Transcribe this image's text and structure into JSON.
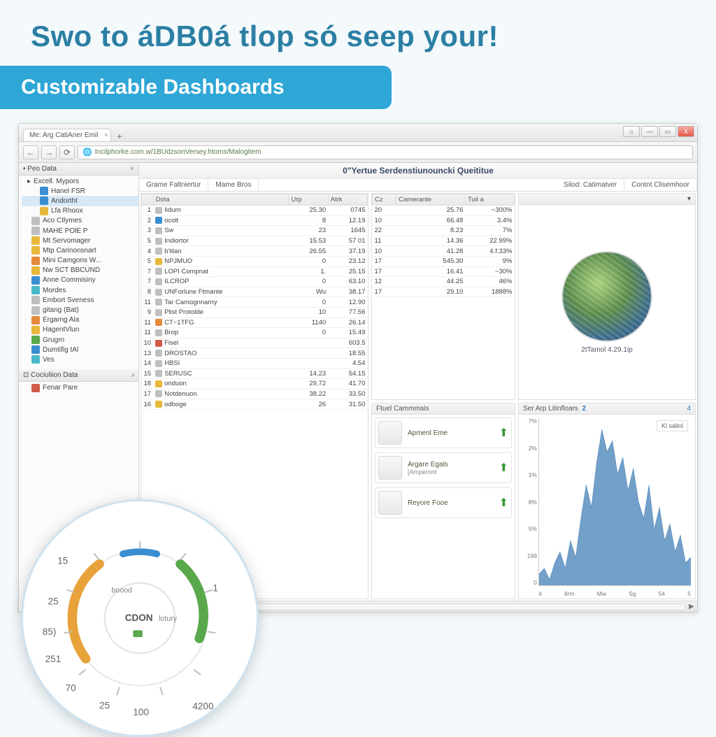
{
  "headline": "Swo to áDB0á tlop só seep your!",
  "banner": "Customizable Dashboards",
  "browser": {
    "tab_title": "Me: Arg CatiAner Emil",
    "url": "Incilphorke.com.w/1BUdzsonVersey.htoms/Malogitem",
    "window_buttons": {
      "home_icon": "⌂",
      "min": "—",
      "max": "▭",
      "close": "X"
    }
  },
  "sidebar": {
    "panel1": {
      "title": "Peo Data"
    },
    "group1_label": "Excell. Mypors",
    "items": [
      {
        "label": "Hanel FSR",
        "icon": "ic-blue",
        "sub": true
      },
      {
        "label": "Andortht",
        "icon": "ic-blue",
        "sub": true,
        "selected": true
      },
      {
        "label": "Lfa Rhoox",
        "icon": "ic-yel",
        "sub": true
      },
      {
        "label": "Aco Ctlymes",
        "icon": "ic-gry",
        "sub": false
      },
      {
        "label": "MAHE POlE P",
        "icon": "ic-gry",
        "sub": false
      },
      {
        "label": "Mt Servomager",
        "icon": "ic-yel",
        "sub": false
      },
      {
        "label": "Mtp Carinonsnart",
        "icon": "ic-yel",
        "sub": false
      },
      {
        "label": "Mini Camgons W...",
        "icon": "ic-org",
        "sub": false
      },
      {
        "label": "Nw SCT BBCUND",
        "icon": "ic-yel",
        "sub": false
      },
      {
        "label": "Anne Commisiny",
        "icon": "ic-blue",
        "sub": false
      },
      {
        "label": "Mordes",
        "icon": "ic-cyn",
        "sub": false
      },
      {
        "label": "Embort Sveness",
        "icon": "ic-gry",
        "sub": false
      },
      {
        "label": "gitang (Bat)",
        "icon": "ic-gry",
        "sub": false
      },
      {
        "label": "Ergarng Ala",
        "icon": "ic-org",
        "sub": false
      },
      {
        "label": "HagentVlun",
        "icon": "ic-yel",
        "sub": false
      },
      {
        "label": "Grugrn",
        "icon": "ic-grn",
        "sub": false
      },
      {
        "label": "Dumtifig tAl",
        "icon": "ic-blue",
        "sub": false
      },
      {
        "label": "Ves",
        "icon": "ic-cyn",
        "sub": false
      }
    ],
    "panel2": {
      "title": "Cociuliion Data"
    },
    "items2": [
      {
        "label": "Fenar Pare",
        "icon": "ic-red"
      }
    ]
  },
  "main": {
    "title": "0\"Yertue Serdenstiunouncki Queititue",
    "subtabs": [
      "Grame  Faltniertur",
      "Mame Bros",
      "Silod:  Catimatver",
      "Contnt Clisemhoor"
    ]
  },
  "table1": {
    "cols": [
      "Dota",
      "Urp",
      "Atrk"
    ],
    "rows": [
      {
        "n": 1,
        "name": "Iidurn",
        "c1": "25.30",
        "c2": "0745",
        "ic": "ic-gry"
      },
      {
        "n": 2,
        "name": "ocolt",
        "c1": "8",
        "c2": "12.19",
        "ic": "ic-blue"
      },
      {
        "n": 3,
        "name": "Sw",
        "c1": "23",
        "c2": "1645",
        "ic": "ic-gry"
      },
      {
        "n": 5,
        "name": "Indiortor",
        "c1": "15.53",
        "c2": "57 01",
        "ic": "ic-gry"
      },
      {
        "n": 4,
        "name": "b'tilan",
        "c1": "26.55",
        "c2": "37.19",
        "ic": "ic-gry"
      },
      {
        "n": 5,
        "name": "NPJMUO",
        "c1": "0",
        "c2": "23.12",
        "ic": "ic-yel"
      },
      {
        "n": 7,
        "name": "LOPI Compnat",
        "c1": "1.",
        "c2": "25.15",
        "ic": "ic-gry"
      },
      {
        "n": 7,
        "name": "ILCROP",
        "c1": "0",
        "c2": "63.10",
        "ic": "ic-gry"
      },
      {
        "n": 8,
        "name": "UNForlune Ftmante",
        "c1": "Wu",
        "c2": "38.17",
        "ic": "ic-gry"
      },
      {
        "n": 11,
        "name": "Tar Camognnarny",
        "c1": "0",
        "c2": "12.90",
        "ic": "ic-gry"
      },
      {
        "n": 9,
        "name": "Plist Protolde",
        "c1": "10",
        "c2": "77.56",
        "ic": "ic-gry"
      },
      {
        "n": 11,
        "name": "CT~1TFG",
        "c1": "1140",
        "c2": "26.14",
        "ic": "ic-org"
      },
      {
        "n": 11,
        "name": "Brop",
        "c1": "0",
        "c2": "15.49",
        "ic": "ic-gry"
      },
      {
        "n": 10,
        "name": "Fisel",
        "c1": "",
        "c2": "603.5",
        "ic": "ic-red"
      },
      {
        "n": 13,
        "name": "DROSTAO",
        "c1": "",
        "c2": "18.55",
        "ic": "ic-gry"
      },
      {
        "n": 14,
        "name": "HBSI",
        "c1": "",
        "c2": "4.54",
        "ic": "ic-gry"
      },
      {
        "n": 15,
        "name": "SERUSC",
        "c1": "14.23",
        "c2": "54.15",
        "ic": "ic-gry"
      },
      {
        "n": 18,
        "name": "onduon",
        "c1": "29.72",
        "c2": "41.70",
        "ic": "ic-yel"
      },
      {
        "n": 17,
        "name": "Notdenuon",
        "c1": "38.22",
        "c2": "33.50",
        "ic": "ic-gry"
      },
      {
        "n": 16,
        "name": "odboge",
        "c1": "26",
        "c2": "31.50",
        "ic": "ic-yel"
      }
    ]
  },
  "table2": {
    "cols": [
      "Cz",
      "Camerante",
      "Tuil a"
    ],
    "rows": [
      {
        "c0": "20",
        "c1": "25.76",
        "c2": "~300%"
      },
      {
        "c0": "10",
        "c1": "66.48",
        "c2": "3.4%"
      },
      {
        "c0": "22",
        "c1": "8.23",
        "c2": "7%"
      },
      {
        "c0": "11",
        "c1": "14.36",
        "c2": "22.99%"
      },
      {
        "c0": "10",
        "c1": "41.28",
        "c2": "4.f.33%"
      },
      {
        "c0": "17",
        "c1": "545.30",
        "c2": "9%"
      },
      {
        "c0": "17",
        "c1": "16.41",
        "c2": "~30%"
      },
      {
        "c0": "12",
        "c1": "44.25",
        "c2": "46%"
      },
      {
        "c0": "17",
        "c1": "29.10",
        "c2": "1888%"
      }
    ]
  },
  "globe": {
    "header": "",
    "caption": "2tTamol 4.29.1ip"
  },
  "cards": {
    "header": "Ftuel Cammmais",
    "items": [
      {
        "label": "Apmenl Eme"
      },
      {
        "label": "Argare Egals",
        "sub": "[Amperont"
      },
      {
        "label": "Reyore Fooe"
      }
    ]
  },
  "chart": {
    "header": "Ser Arp Litinfloars",
    "badge": "2",
    "corner": "4",
    "legend": "Kl salinl"
  },
  "chart_data": {
    "type": "area",
    "xlabel": "",
    "ylabel": "",
    "x_ticks": [
      "4",
      "8rm",
      "Mw",
      "Sg",
      "54",
      "5"
    ],
    "y_ticks": [
      "7%",
      "2%",
      "1%",
      "8%",
      "5%",
      "199",
      "0"
    ],
    "ylim": [
      0,
      30
    ],
    "x": [
      0,
      1,
      2,
      3,
      4,
      5,
      6,
      7,
      8,
      9,
      10,
      11,
      12,
      13,
      14,
      15,
      16,
      17,
      18,
      19,
      20,
      21,
      22,
      23,
      24,
      25,
      26,
      27,
      28,
      29
    ],
    "values": [
      2,
      3,
      1,
      4,
      6,
      3,
      8,
      5,
      12,
      18,
      14,
      22,
      28,
      24,
      26,
      20,
      23,
      17,
      21,
      15,
      12,
      18,
      10,
      14,
      8,
      11,
      6,
      9,
      4,
      5
    ],
    "color": "#5a8fbf"
  },
  "gauge": {
    "center_label": "CDON",
    "side_label": "lotury",
    "ticks_outer": [
      "15",
      "25",
      "85)",
      "251",
      "70",
      "25",
      "100",
      "1",
      "",
      "4200"
    ],
    "ticks_inner": [
      "boood",
      "",
      "",
      ""
    ]
  }
}
